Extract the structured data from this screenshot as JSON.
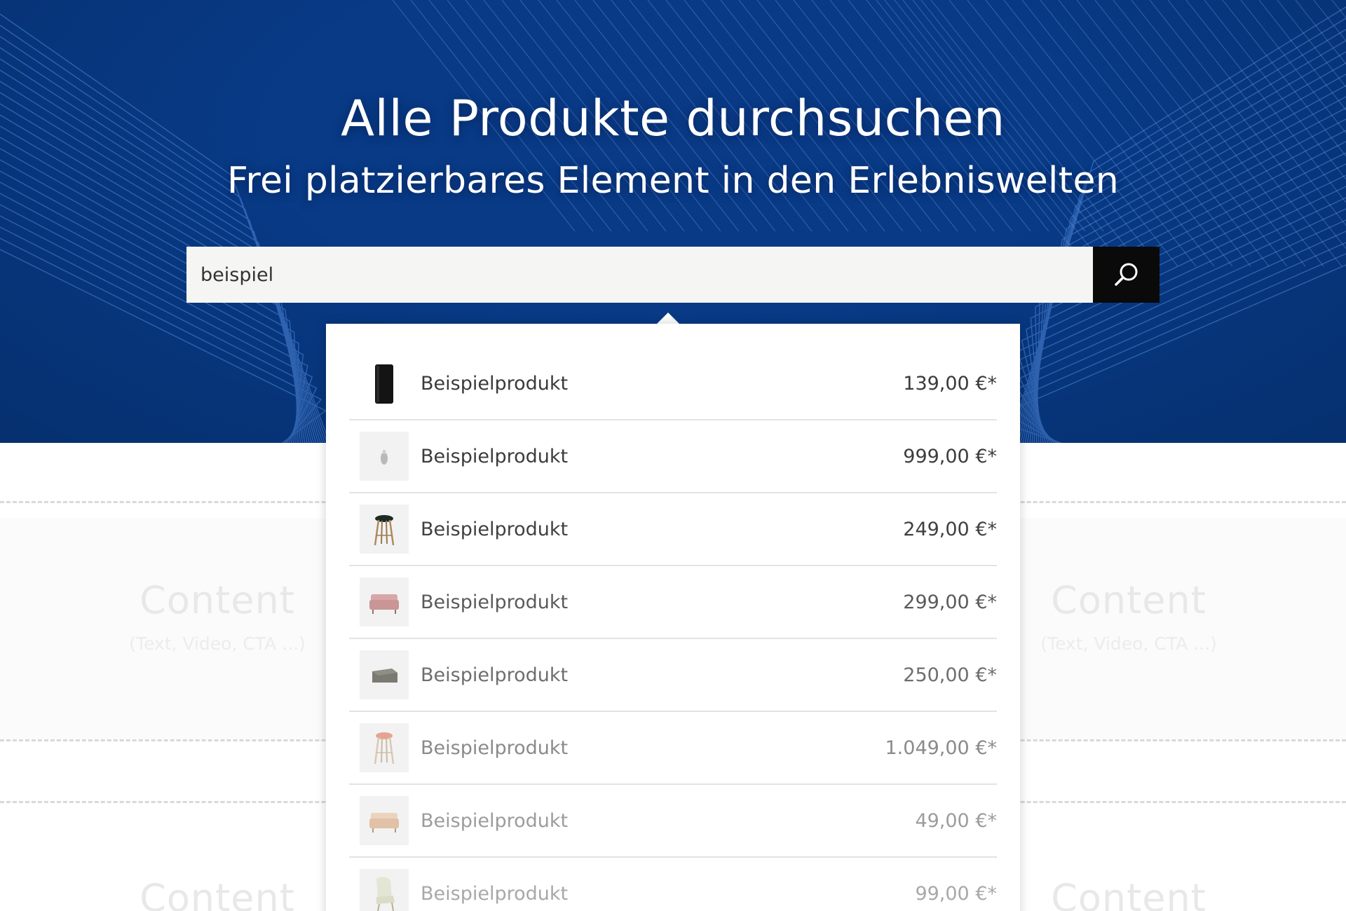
{
  "hero": {
    "title": "Alle Produkte durchsuchen",
    "subtitle": "Frei platzierbares Element in den Erlebniswelten"
  },
  "search": {
    "value": "beispiel",
    "button_icon": "search-icon"
  },
  "background_content": [
    {
      "title": "Content",
      "sub": "(Text, Video, CTA ...)"
    },
    {
      "title": "Content",
      "sub": "(Text, Video, CTA ...)"
    },
    {
      "title": "Content"
    },
    {
      "title": "Content"
    }
  ],
  "results": [
    {
      "name": "Beispielprodukt",
      "price": "139,00 €*",
      "thumb": "speaker-icon"
    },
    {
      "name": "Beispielprodukt",
      "price": "999,00 €*",
      "thumb": "vase-icon"
    },
    {
      "name": "Beispielprodukt",
      "price": "249,00 €*",
      "thumb": "bar-stool-dark-icon"
    },
    {
      "name": "Beispielprodukt",
      "price": "299,00 €*",
      "thumb": "pink-sofa-icon"
    },
    {
      "name": "Beispielprodukt",
      "price": "250,00 €*",
      "thumb": "grey-ottoman-icon"
    },
    {
      "name": "Beispielprodukt",
      "price": "1.049,00 €*",
      "thumb": "bar-stool-red-icon"
    },
    {
      "name": "Beispielprodukt",
      "price": "49,00 €*",
      "thumb": "beige-sofa-icon"
    },
    {
      "name": "Beispielprodukt",
      "price": "99,00 €*",
      "thumb": "lounge-chair-icon"
    }
  ],
  "colors": {
    "hero_blue": "#083a86",
    "button_black": "#0a0a0a",
    "text_dark": "#3a3a3a"
  }
}
